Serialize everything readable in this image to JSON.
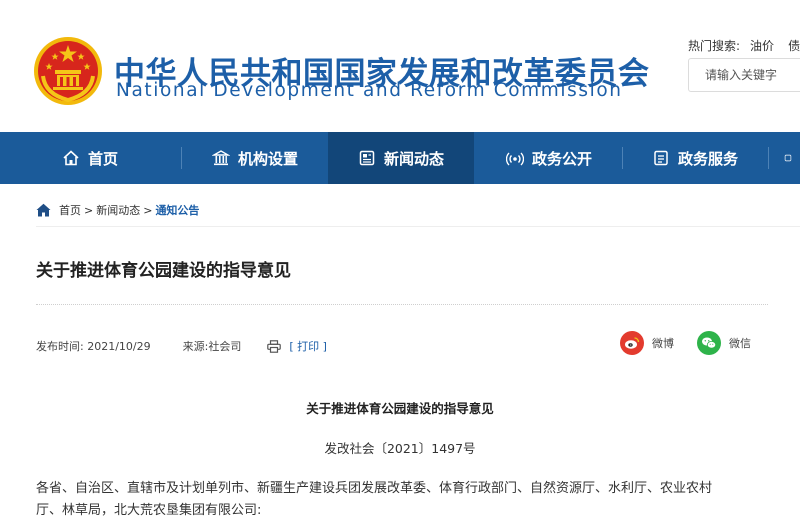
{
  "header": {
    "title_cn": "中华人民共和国国家发展和改革委员会",
    "title_en": "National Development and Reform Commission",
    "hot_search_label": "热门搜索:",
    "hot_search_terms": [
      "油价",
      "债券"
    ],
    "search_placeholder": "请输入关键字"
  },
  "nav": {
    "items": [
      {
        "label": "首页",
        "icon": "home-icon"
      },
      {
        "label": "机构设置",
        "icon": "building-icon"
      },
      {
        "label": "新闻动态",
        "icon": "newspaper-icon",
        "active": true
      },
      {
        "label": "政务公开",
        "icon": "broadcast-icon"
      },
      {
        "label": "政务服务",
        "icon": "document-icon"
      }
    ],
    "colors": {
      "bar": "#1b5b9a",
      "active": "#124679"
    }
  },
  "breadcrumb": {
    "items": [
      "首页",
      "新闻动态",
      "通知公告"
    ],
    "separator": ">"
  },
  "article": {
    "title": "关于推进体育公园建设的指导意见",
    "publish_label": "发布时间:",
    "publish_date": "2021/10/29",
    "source_label": "来源:",
    "source": "社会司",
    "print_label": "[ 打印 ]",
    "share": [
      {
        "label": "微博",
        "icon": "weibo-icon",
        "color": "#e33b2e"
      },
      {
        "label": "微信",
        "icon": "wechat-icon",
        "color": "#2eb34a"
      }
    ],
    "doc_title": "关于推进体育公园建设的指导意见",
    "doc_number": "发改社会〔2021〕1497号",
    "body_line_1": "各省、自治区、直辖市及计划单列市、新疆生产建设兵团发展改革委、体育行政部门、自然资源厅、水利厅、农业农村",
    "body_line_2": "厅、林草局，北大荒农垦集团有限公司:"
  },
  "colors": {
    "brand_blue": "#1d5fa8",
    "emblem_red": "#d7261c",
    "emblem_gold": "#f5c518"
  }
}
